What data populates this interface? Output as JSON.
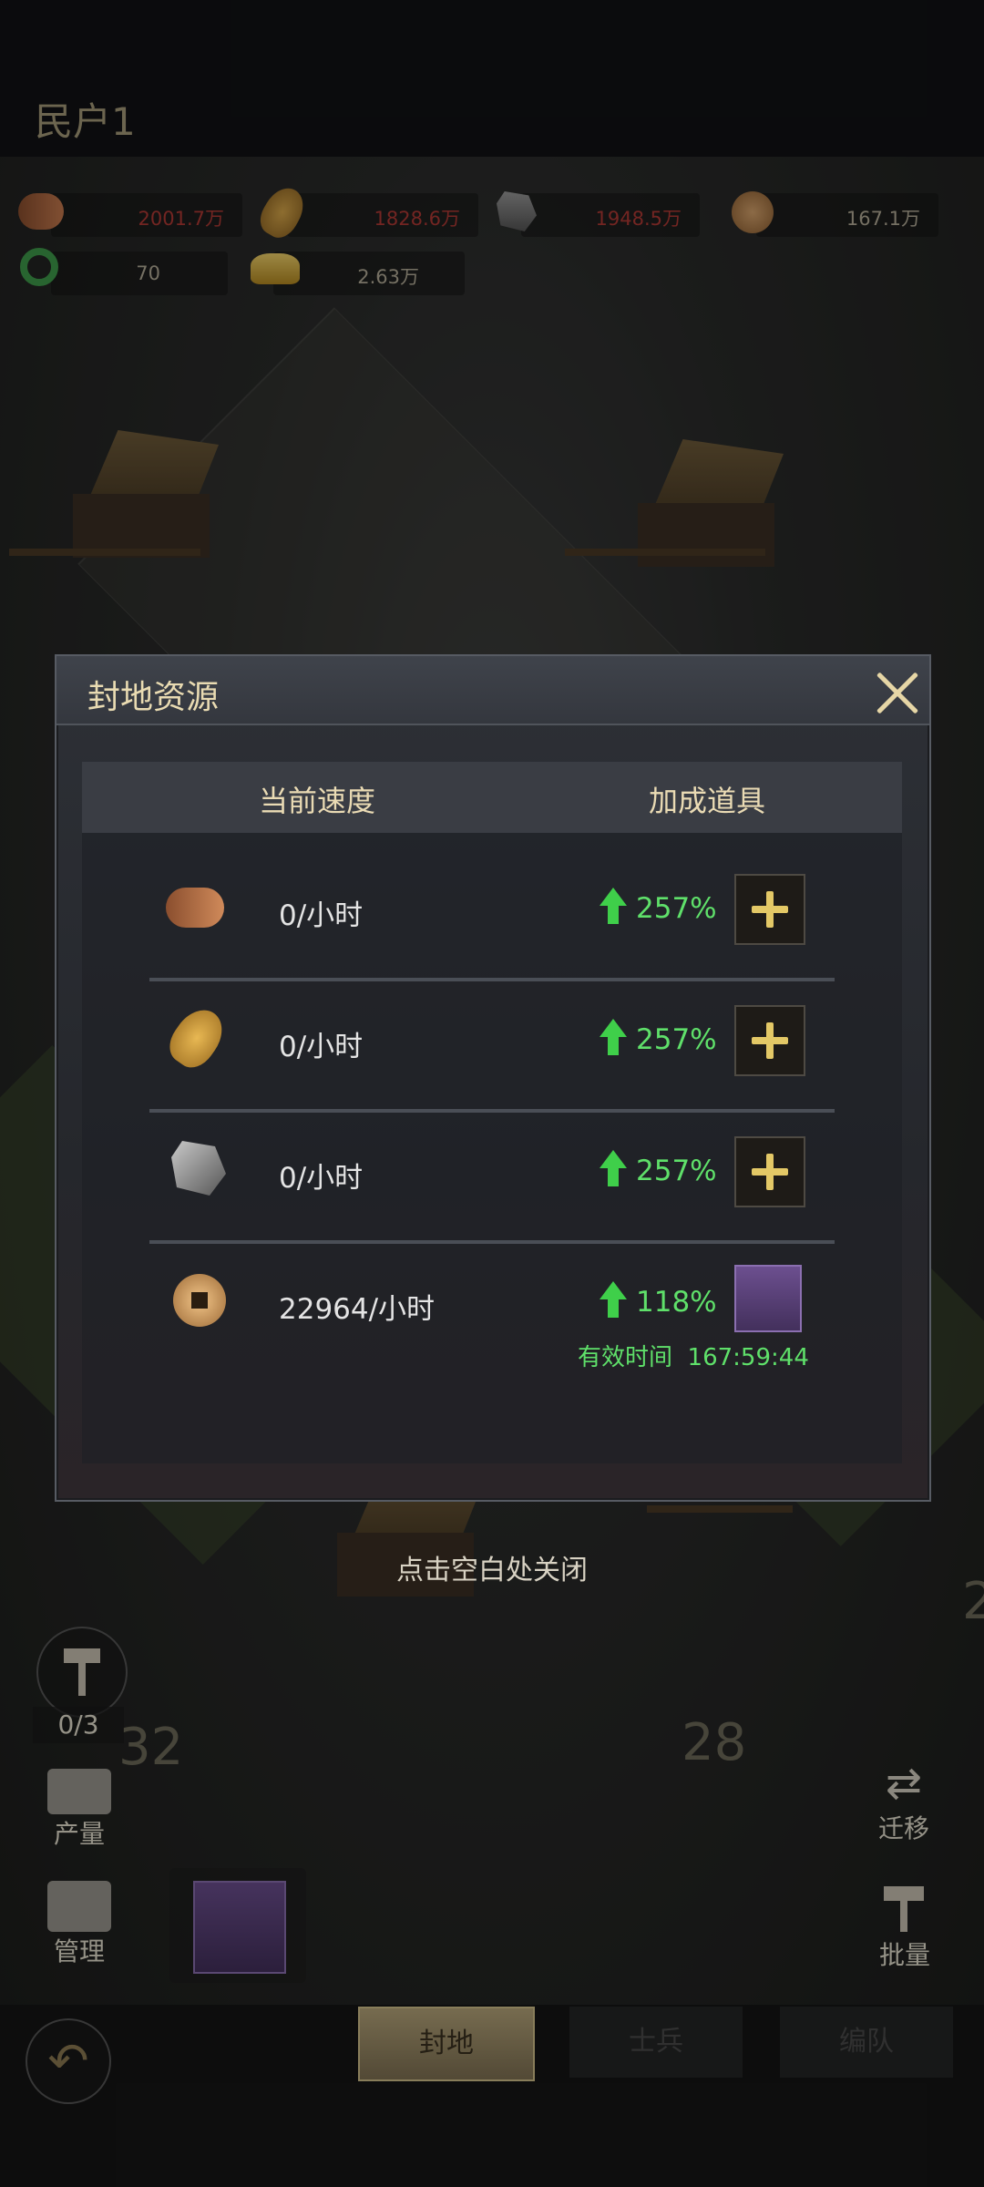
{
  "header": {
    "title": "民户1"
  },
  "resources": [
    {
      "icon": "wood-log-icon",
      "value": "2001.7万",
      "color": "#b13a35"
    },
    {
      "icon": "wheat-icon",
      "value": "1828.6万",
      "color": "#b13a35"
    },
    {
      "icon": "iron-ore-icon",
      "value": "1948.5万",
      "color": "#b13a35"
    },
    {
      "icon": "copper-coin-icon",
      "value": "167.1万",
      "color": "#b4ad98"
    },
    {
      "icon": "jade-plus-icon",
      "value": "70",
      "color": "#b4ad98"
    },
    {
      "icon": "gold-ingot-plus-icon",
      "value": "2.63万",
      "color": "#b4ad98"
    }
  ],
  "map_numbers": {
    "left": "32",
    "center": "28",
    "right": "2"
  },
  "dialog": {
    "title": "封地资源",
    "col_speed": "当前速度",
    "col_bonus": "加成道具",
    "rows": [
      {
        "icon": "wood-log-icon",
        "rate": "0/小时",
        "bonus": "257%"
      },
      {
        "icon": "wheat-icon",
        "rate": "0/小时",
        "bonus": "257%"
      },
      {
        "icon": "iron-ore-icon",
        "rate": "0/小时",
        "bonus": "257%"
      },
      {
        "icon": "copper-coin-icon",
        "rate": "22964/小时",
        "bonus": "118%",
        "effective_label": "有效时间",
        "effective_time": "167:59:44"
      }
    ],
    "close_hint": "点击空白处关闭"
  },
  "left_buttons": {
    "hammer_count": "0/3",
    "output": "产量",
    "manage": "管理"
  },
  "right_buttons": {
    "migrate": "迁移",
    "batch": "批量"
  },
  "tabs": [
    {
      "label": "封地",
      "active": true
    },
    {
      "label": "士兵",
      "active": false
    },
    {
      "label": "编队",
      "active": false
    }
  ]
}
